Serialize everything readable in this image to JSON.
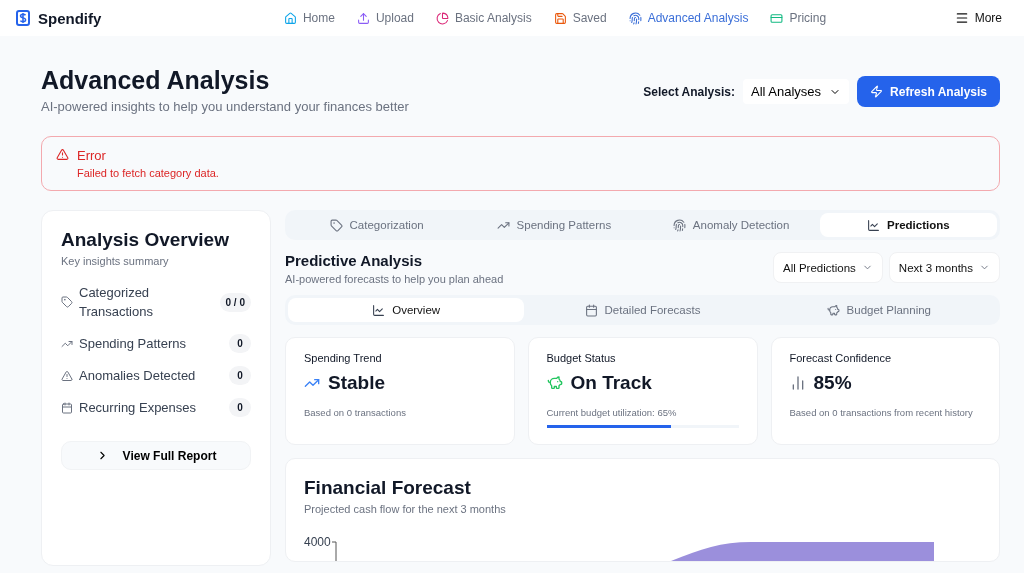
{
  "brand": "Spendify",
  "nav": [
    {
      "label": "Home",
      "kind": "home",
      "selected": false
    },
    {
      "label": "Upload",
      "kind": "upload",
      "selected": false
    },
    {
      "label": "Basic Analysis",
      "kind": "pie",
      "selected": false
    },
    {
      "label": "Saved",
      "kind": "save",
      "selected": false
    },
    {
      "label": "Advanced Analysis",
      "kind": "fingerprint",
      "selected": true
    },
    {
      "label": "Pricing",
      "kind": "card",
      "selected": false
    }
  ],
  "more": "More",
  "page": {
    "title": "Advanced Analysis",
    "subtitle": "AI-powered insights to help you understand your finances better",
    "select_label": "Select Analysis:",
    "select_value": "All Analyses",
    "refresh": "Refresh Analysis"
  },
  "error": {
    "title": "Error",
    "message": "Failed to fetch category data."
  },
  "overview": {
    "title": "Analysis Overview",
    "subtitle": "Key insights summary",
    "items": [
      {
        "label": "Categorized Transactions",
        "kind": "tag",
        "count": "0 / 0"
      },
      {
        "label": "Spending Patterns",
        "kind": "trend",
        "count": "0"
      },
      {
        "label": "Anomalies Detected",
        "kind": "alert",
        "count": "0"
      },
      {
        "label": "Recurring Expenses",
        "kind": "calendar",
        "count": "0"
      }
    ],
    "report": "View Full Report"
  },
  "tabs": [
    {
      "label": "Categorization",
      "kind": "tag",
      "selected": false
    },
    {
      "label": "Spending Patterns",
      "kind": "trend",
      "selected": false
    },
    {
      "label": "Anomaly Detection",
      "kind": "fingerprint",
      "selected": false
    },
    {
      "label": "Predictions",
      "kind": "chart",
      "selected": true
    }
  ],
  "predictive": {
    "title": "Predictive Analysis",
    "subtitle": "AI-powered forecasts to help you plan ahead",
    "filters": [
      "All Predictions",
      "Next 3 months"
    ]
  },
  "subtabs": [
    {
      "label": "Overview",
      "kind": "chart",
      "selected": true
    },
    {
      "label": "Detailed Forecasts",
      "kind": "calendar",
      "selected": false
    },
    {
      "label": "Budget Planning",
      "kind": "piggy",
      "selected": false
    }
  ],
  "cards": [
    {
      "title": "Spending Trend",
      "kind": "trend",
      "value": "Stable",
      "note": "Based on 0 transactions"
    },
    {
      "title": "Budget Status",
      "kind": "budget",
      "value": "On Track",
      "note": "Current budget utilization: 65%",
      "level": 0.65
    },
    {
      "title": "Forecast Confidence",
      "kind": "bars",
      "value": "85%",
      "note": "Based on 0 transactions from recent history"
    }
  ],
  "forecast": {
    "title": "Financial Forecast",
    "subtitle": "Projected cash flow for the next 3 months",
    "y_tick": "4000"
  }
}
